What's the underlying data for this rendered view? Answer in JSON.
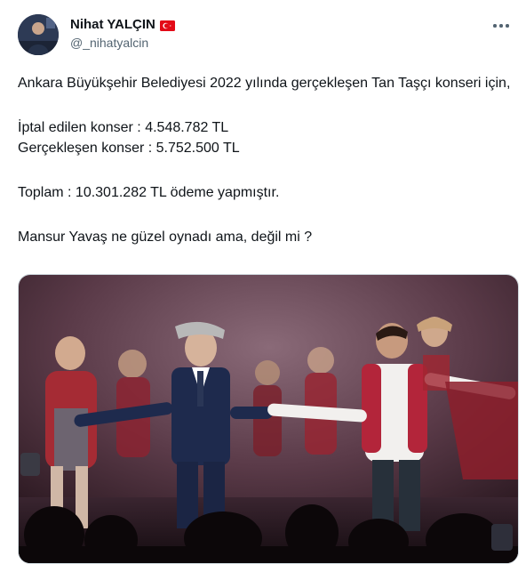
{
  "author": {
    "display_name": "Nihat YALÇIN",
    "handle": "@_nihatyalcin",
    "flag": "turkey-flag-icon"
  },
  "tweet": {
    "lines": [
      "Ankara Büyükşehir Belediyesi 2022 yılında gerçekleşen Tan Taşçı konseri için,",
      "İptal edilen konser : 4.548.782 TL",
      "Gerçekleşen konser : 5.752.500 TL",
      "Toplam : 10.301.282 TL ödeme yapmıştır.",
      "Mansur Yavaş ne güzel oynadı ama, değil mi ?"
    ]
  },
  "media": {
    "type": "photo",
    "subject": "stage-dancers-photo"
  },
  "colors": {
    "text": "#0f1419",
    "secondary": "#536471",
    "border": "#cfd9de"
  },
  "icons": [
    "more-icon",
    "turkey-flag-icon",
    "avatar"
  ]
}
